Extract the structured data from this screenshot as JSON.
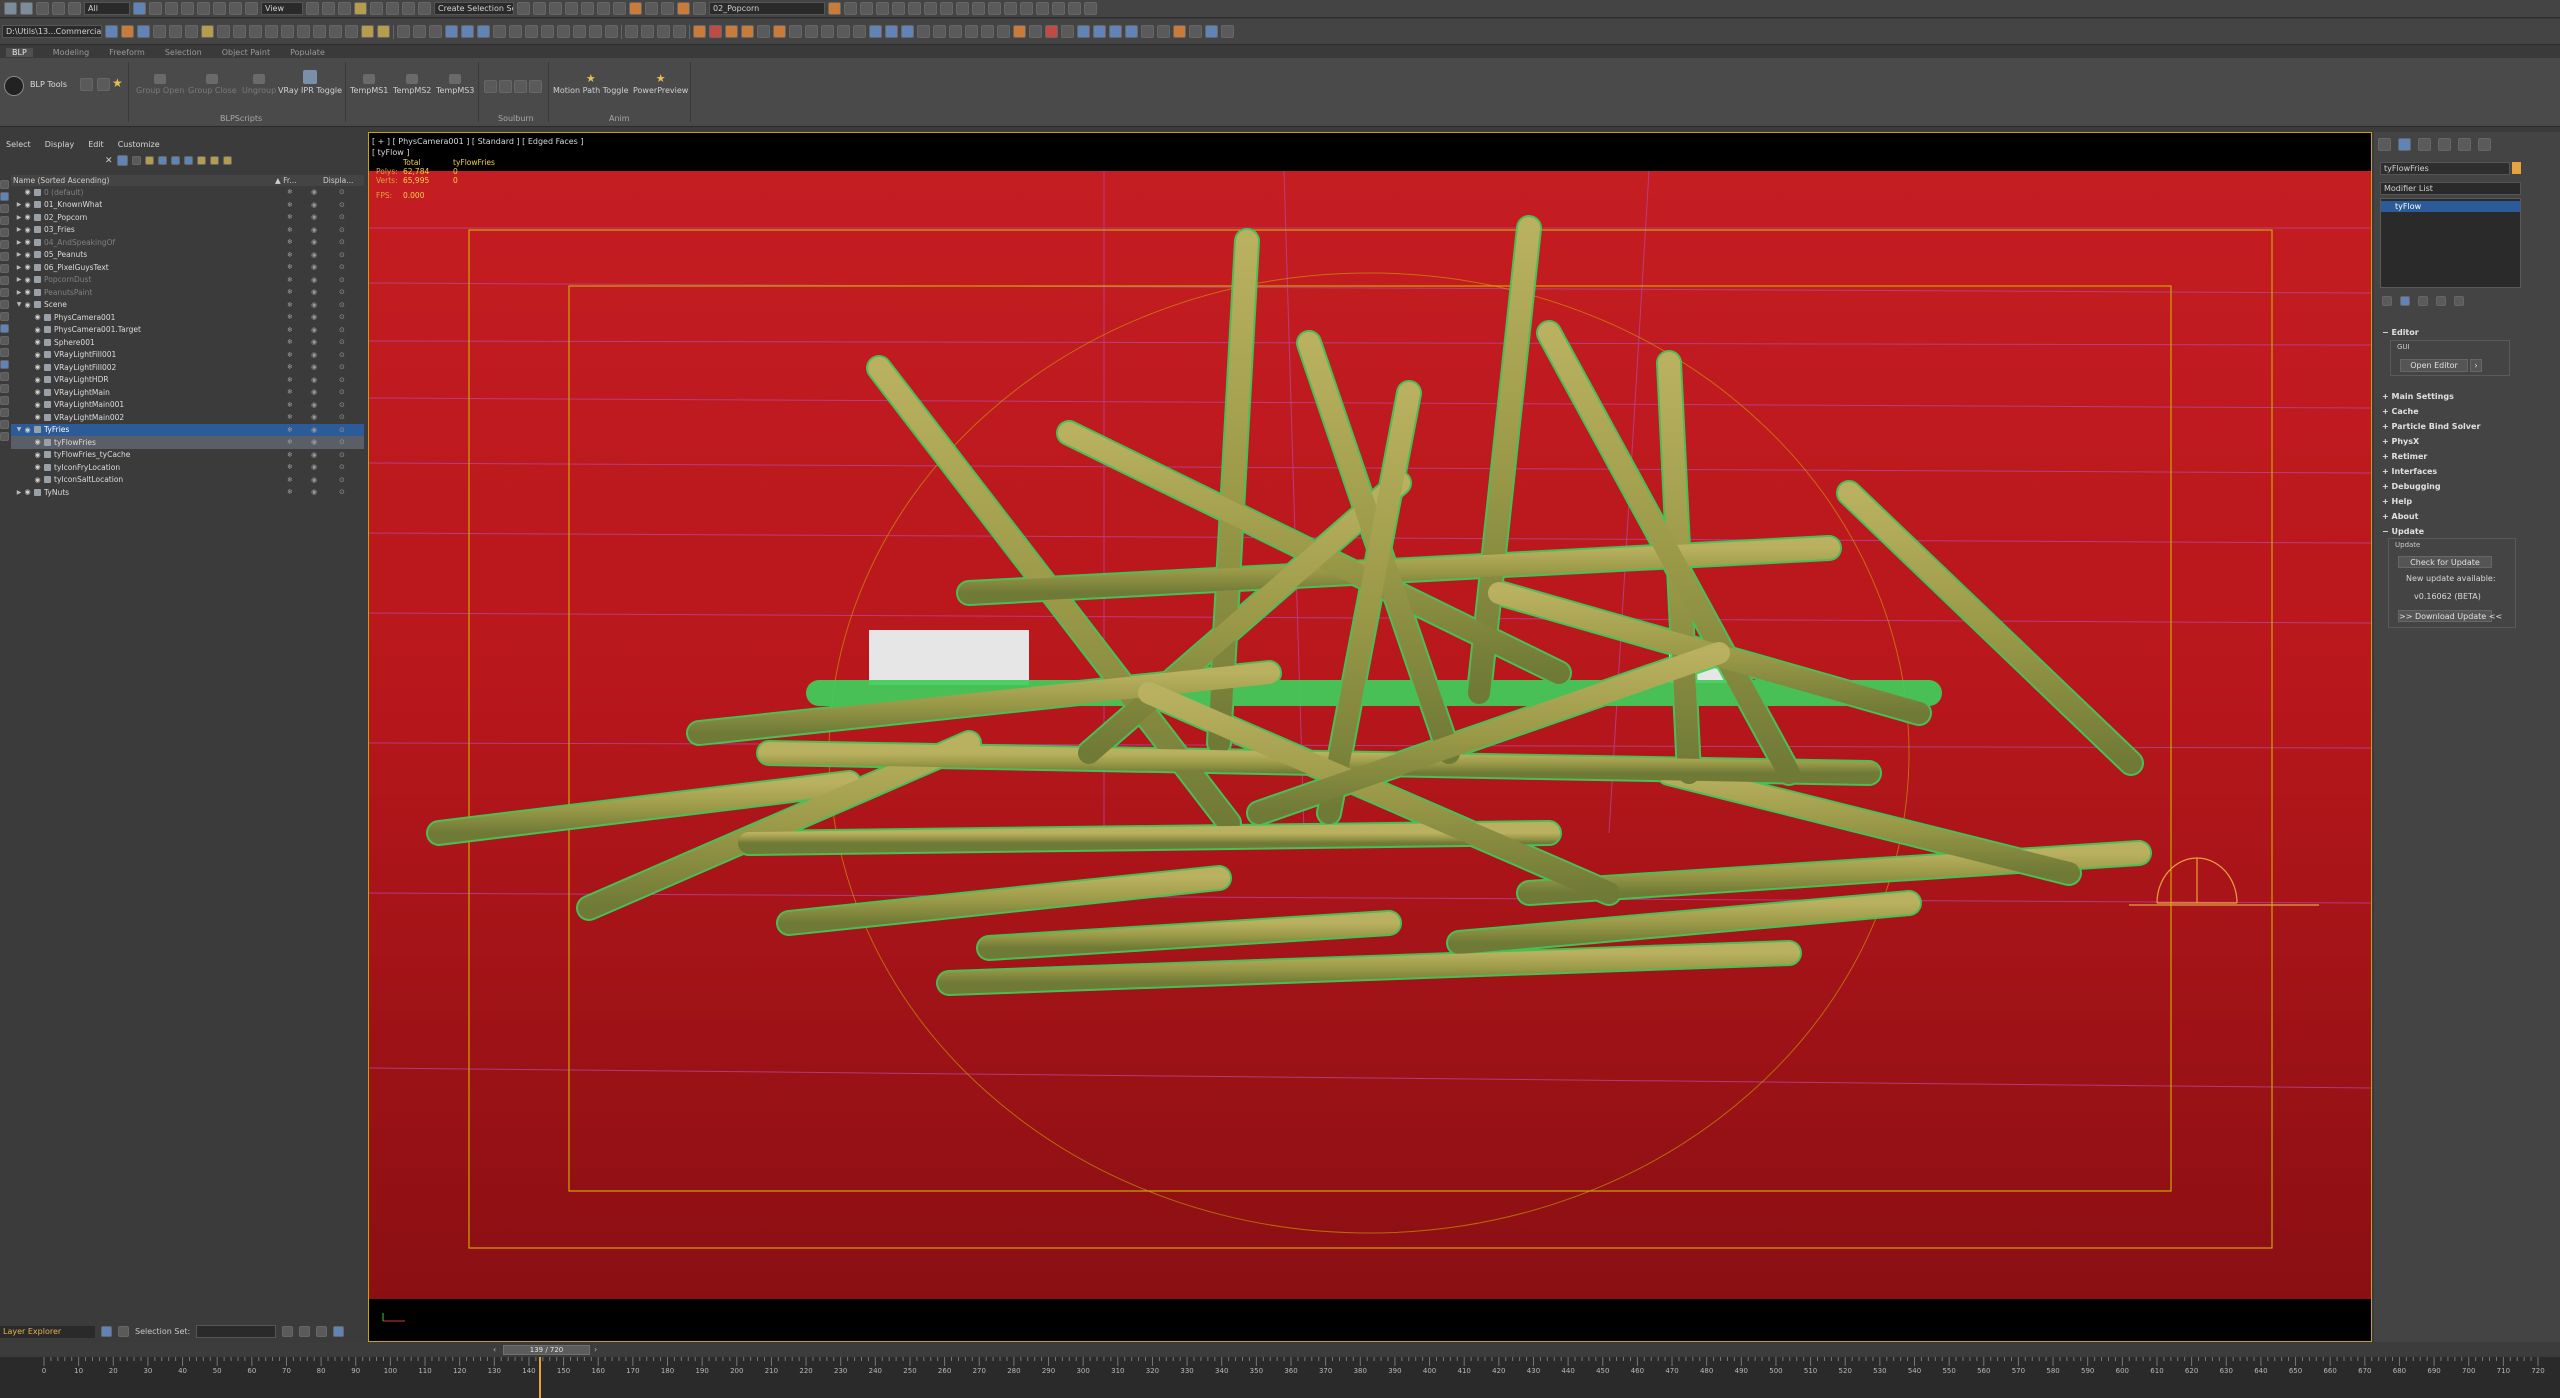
{
  "colors": {
    "viewport_bg": "#b8171c",
    "fries": "#a0a050",
    "wire": "#3fcf5a",
    "safe_frame": "#c9a500",
    "selection": "#2c5b9a"
  },
  "toolbar": {
    "selection_filter": "All",
    "view_dropdown": "View",
    "create_selection_set": "Create Selection Se",
    "layer_dropdown": "02_Popcorn",
    "workspace": "D:\\Utils\\13...Commercial"
  },
  "ribbon": {
    "tabs": [
      "BLP",
      "Modeling",
      "Freeform",
      "Selection",
      "Object Paint",
      "Populate"
    ],
    "blp_tools": "BLP Tools",
    "buttons": {
      "group_open": "Group Open",
      "group_close": "Group Close",
      "ungroup": "Ungroup",
      "vray_ipr_toggle": "VRay IPR Toggle",
      "tempms1": "TempMS1",
      "tempms2": "TempMS2",
      "tempms3": "TempMS3",
      "motion_path_toggle": "Motion Path Toggle",
      "powerpreview": "PowerPreview"
    },
    "groups": [
      "BLPScripts",
      "Soulburn",
      "Anim"
    ]
  },
  "scene_explorer": {
    "menu": [
      "Select",
      "Display",
      "Edit",
      "Customize"
    ],
    "col_name": "Name (Sorted Ascending)",
    "col_fr": "▲ Fr...",
    "col_disp": "Displa...",
    "rows": [
      {
        "name": "0 (default)",
        "level": 1,
        "dim": true,
        "arrow": ""
      },
      {
        "name": "01_KnownWhat",
        "level": 1,
        "arrow": "▶"
      },
      {
        "name": "02_Popcorn",
        "level": 1,
        "arrow": "▶"
      },
      {
        "name": "03_Fries",
        "level": 1,
        "arrow": "▶"
      },
      {
        "name": "04_AndSpeakingOf",
        "level": 1,
        "dim": true,
        "arrow": "▶"
      },
      {
        "name": "05_Peanuts",
        "level": 1,
        "arrow": "▶"
      },
      {
        "name": "06_PixelGuysText",
        "level": 1,
        "arrow": "▶"
      },
      {
        "name": "PopcornDust",
        "level": 1,
        "dim": true,
        "arrow": "▶"
      },
      {
        "name": "PeanutsPaint",
        "level": 1,
        "dim": true,
        "arrow": "▶"
      },
      {
        "name": "Scene",
        "level": 1,
        "arrow": "▼"
      },
      {
        "name": "PhysCamera001",
        "level": 2,
        "arrow": ""
      },
      {
        "name": "PhysCamera001.Target",
        "level": 2,
        "arrow": ""
      },
      {
        "name": "Sphere001",
        "level": 2,
        "arrow": ""
      },
      {
        "name": "VRayLightFill001",
        "level": 2,
        "arrow": ""
      },
      {
        "name": "VRayLightFill002",
        "level": 2,
        "arrow": ""
      },
      {
        "name": "VRayLightHDR",
        "level": 2,
        "arrow": ""
      },
      {
        "name": "VRayLightMain",
        "level": 2,
        "arrow": ""
      },
      {
        "name": "VRayLightMain001",
        "level": 2,
        "arrow": ""
      },
      {
        "name": "VRayLightMain002",
        "level": 2,
        "arrow": ""
      },
      {
        "name": "TyFries",
        "level": 1,
        "arrow": "▼",
        "hl": true
      },
      {
        "name": "tyFlowFries",
        "level": 2,
        "arrow": "",
        "sel": true
      },
      {
        "name": "tyFlowFries_tyCache",
        "level": 2,
        "arrow": ""
      },
      {
        "name": "tyIconFryLocation",
        "level": 2,
        "arrow": ""
      },
      {
        "name": "tyIconSaltLocation",
        "level": 2,
        "arrow": ""
      },
      {
        "name": "TyNuts",
        "level": 1,
        "arrow": "▶"
      }
    ],
    "bottom": {
      "mode": "Layer Explorer",
      "selection_set_label": "Selection Set:"
    }
  },
  "viewport": {
    "label": "[ + ] [ PhysCamera001 ] [ Standard ] [ Edged Faces ]",
    "sub_label": "[ tyFlow ]",
    "stats": {
      "col_total": "Total",
      "col_sel": "tyFlowFries",
      "polys_label": "Polys:",
      "polys_total": "62,784",
      "polys_sel": "0",
      "verts_label": "Verts:",
      "verts_total": "65,995",
      "verts_sel": "0",
      "fps_label": "FPS:",
      "fps_value": "0.000"
    }
  },
  "command_panel": {
    "object_name": "tyFlowFries",
    "modifier_list": "Modifier List",
    "stack_item": "tyFlow",
    "rollouts": {
      "editor": "Editor",
      "gui": "GUI",
      "open_editor": "Open Editor",
      "main_settings": "Main Settings",
      "cache": "Cache",
      "particle_bind_solver": "Particle Bind Solver",
      "physx": "PhysX",
      "retimer": "Retimer",
      "interfaces": "Interfaces",
      "debugging": "Debugging",
      "help": "Help",
      "about": "About",
      "update": "Update",
      "update_sub": "Update",
      "check_for_update": "Check for Update",
      "new_update": "New update available:",
      "version": "v0.16062 (BETA)",
      "download_update": ">> Download Update <<"
    }
  },
  "timeline": {
    "frame_display": "139 / 720",
    "ticks": [
      "0",
      "10",
      "20",
      "30",
      "40",
      "50",
      "60",
      "70",
      "80",
      "90",
      "100",
      "110",
      "120",
      "130",
      "140",
      "150",
      "160",
      "170",
      "180",
      "190",
      "200",
      "210",
      "220",
      "230",
      "240",
      "250",
      "260",
      "270",
      "280",
      "290",
      "300",
      "310",
      "320",
      "330",
      "340",
      "350",
      "360",
      "370",
      "380",
      "390",
      "400",
      "410",
      "420",
      "430",
      "440",
      "450",
      "460",
      "470",
      "480",
      "490",
      "500",
      "510",
      "520",
      "530",
      "540",
      "550",
      "560",
      "570",
      "580",
      "590",
      "600",
      "610",
      "620",
      "630",
      "640",
      "650",
      "660",
      "670",
      "680",
      "690",
      "700",
      "710",
      "720"
    ]
  }
}
